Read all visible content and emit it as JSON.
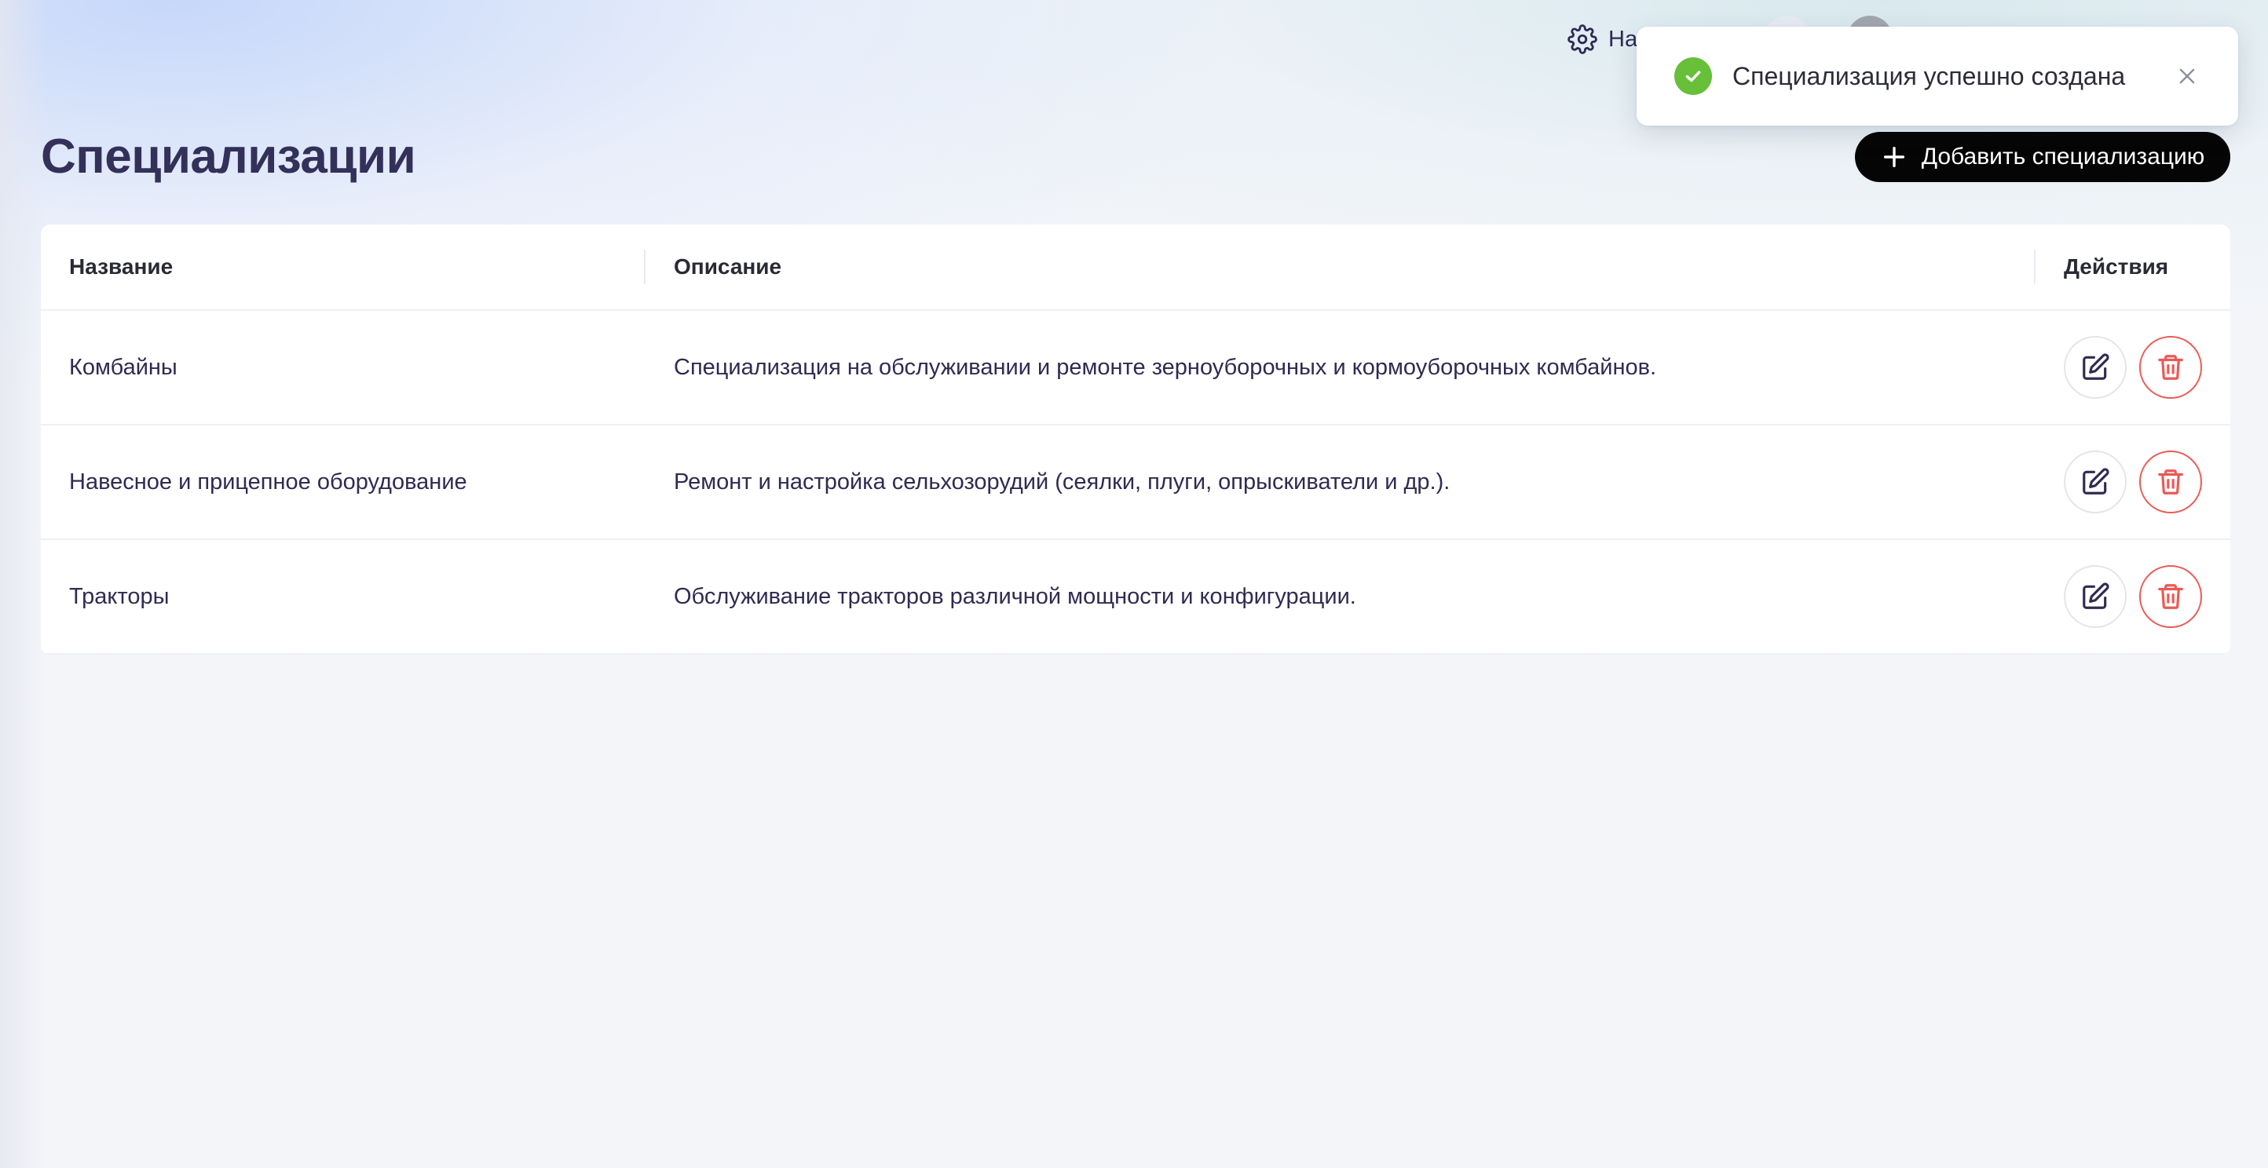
{
  "header": {
    "settings_label": "На"
  },
  "toast": {
    "message": "Специализация успешно создана",
    "status_color": "#67bf3a"
  },
  "page": {
    "title": "Специализации",
    "add_button_label": "Добавить специализацию"
  },
  "table": {
    "columns": [
      "Название",
      "Описание",
      "Действия"
    ],
    "rows": [
      {
        "name": "Комбайны",
        "description": "Специализация на обслуживании и ремонте зерноуборочных и кормоуборочных комбайнов."
      },
      {
        "name": "Навесное и прицепное оборудование",
        "description": "Ремонт и настройка сельхозорудий (сеялки, плуги, опрыскиватели и др.)."
      },
      {
        "name": "Тракторы",
        "description": "Обслуживание тракторов различной мощности и конфигурации."
      }
    ]
  },
  "icons": {
    "settings": "gear-icon",
    "add": "plus-icon",
    "edit": "pencil-square-icon",
    "delete": "trash-icon",
    "toast_status": "check-circle-icon",
    "toast_close": "close-icon"
  },
  "colors": {
    "primary_button": "#050505",
    "delete_accent": "#ea5a55",
    "title_text": "#33305a"
  }
}
